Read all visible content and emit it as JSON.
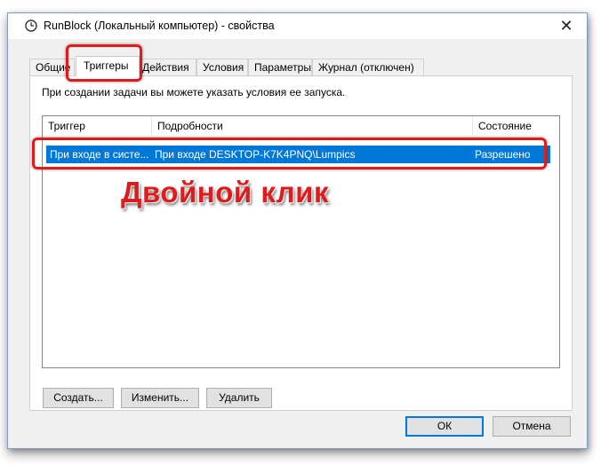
{
  "window": {
    "title": "RunBlock (Локальный компьютер) - свойства",
    "icon": "clock-icon",
    "close_glyph": "✕"
  },
  "tabs": [
    {
      "label": "Общие"
    },
    {
      "label": "Триггеры",
      "active": true
    },
    {
      "label": "Действия"
    },
    {
      "label": "Условия"
    },
    {
      "label": "Параметры"
    },
    {
      "label": "Журнал (отключен)"
    }
  ],
  "panel": {
    "description": "При создании задачи вы можете указать условия ее запуска."
  },
  "list": {
    "columns": [
      "Триггер",
      "Подробности",
      "Состояние"
    ],
    "rows": [
      {
        "trigger": "При входе в систе...",
        "details": "При входе DESKTOP-K7K4PNQ\\Lumpics",
        "status": "Разрешено",
        "selected": true
      }
    ]
  },
  "buttons": {
    "create": "Создать...",
    "edit": "Изменить...",
    "delete": "Удалить"
  },
  "footer": {
    "ok": "ОК",
    "cancel": "Отмена"
  },
  "annotation": {
    "text": "Двойной клик",
    "color": "#e11b1b"
  },
  "colors": {
    "selection": "#0078d7",
    "highlight": "#e11b1b"
  }
}
